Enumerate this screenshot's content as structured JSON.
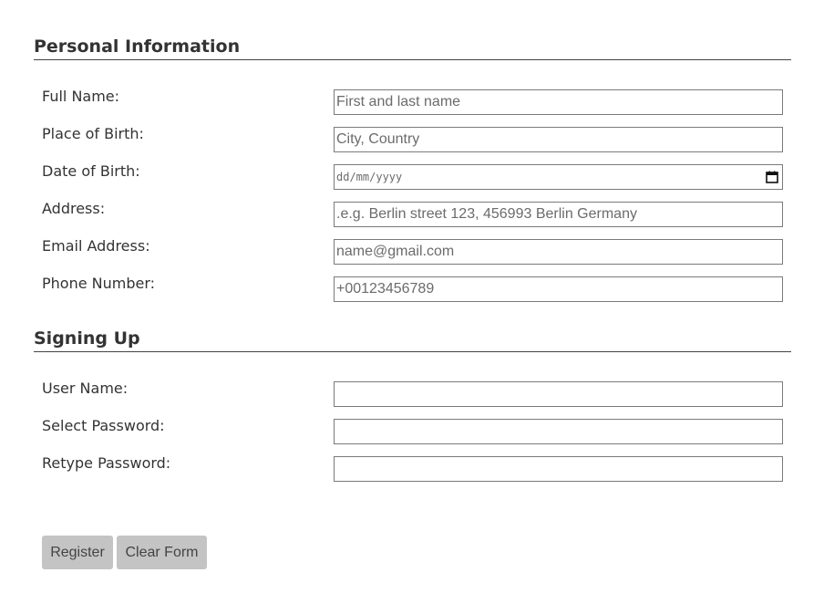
{
  "personal_section": {
    "title": "Personal Information",
    "fields": [
      {
        "label": "Full Name:",
        "placeholder": "First and last name",
        "value": ""
      },
      {
        "label": "Place of Birth:",
        "placeholder": "City, Country",
        "value": ""
      },
      {
        "label": "Date of Birth:",
        "placeholder": "dd/mm/yyyy",
        "value": ""
      },
      {
        "label": "Address:",
        "placeholder": ".e.g. Berlin street 123, 456993 Berlin Germany",
        "value": ""
      },
      {
        "label": "Email Address:",
        "placeholder": "name@gmail.com",
        "value": ""
      },
      {
        "label": "Phone Number:",
        "placeholder": "+00123456789",
        "value": ""
      }
    ]
  },
  "signup_section": {
    "title": "Signing Up",
    "fields": [
      {
        "label": "User Name:",
        "value": ""
      },
      {
        "label": "Select Password:",
        "value": ""
      },
      {
        "label": "Retype Password:",
        "value": ""
      }
    ]
  },
  "buttons": {
    "register": "Register",
    "clear": "Clear Form"
  },
  "icons": {
    "date_picker": "calendar-icon"
  },
  "colors": {
    "button_bg": "#c4c4c4",
    "text": "#333333",
    "field_border": "#7a7a7a"
  }
}
